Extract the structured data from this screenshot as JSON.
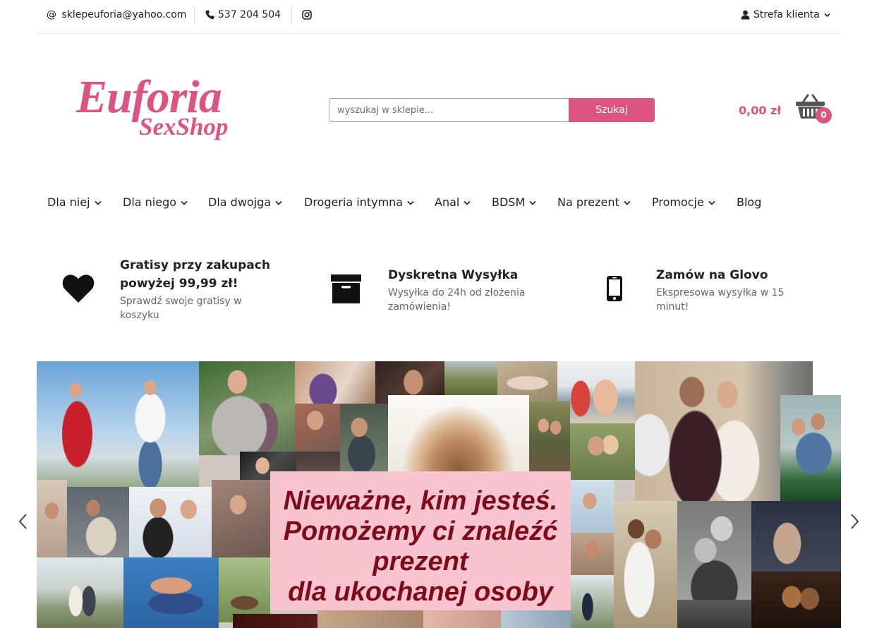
{
  "topbar": {
    "email": "sklepeuforia@yahoo.com",
    "phone": "537 204 504",
    "account_label": "Strefa klienta",
    "icons": [
      "at-icon",
      "phone-icon",
      "instagram-icon",
      "user-icon",
      "chevron-down-icon"
    ]
  },
  "logo": {
    "main": "Euforia",
    "sub": "SexShop"
  },
  "search": {
    "placeholder": "wyszukaj w sklepie...",
    "button_label": "Szukaj"
  },
  "cart": {
    "total": "0,00 zł",
    "count": "0",
    "icon": "basket-icon"
  },
  "nav": {
    "items": [
      {
        "label": "Dla niej",
        "has_dropdown": true
      },
      {
        "label": "Dla niego",
        "has_dropdown": true
      },
      {
        "label": "Dla dwojga",
        "has_dropdown": true
      },
      {
        "label": "Drogeria intymna",
        "has_dropdown": true
      },
      {
        "label": "Anal",
        "has_dropdown": true
      },
      {
        "label": "BDSM",
        "has_dropdown": true
      },
      {
        "label": "Na prezent",
        "has_dropdown": true
      },
      {
        "label": "Promocje",
        "has_dropdown": true
      },
      {
        "label": "Blog",
        "has_dropdown": false
      }
    ]
  },
  "features": [
    {
      "icon": "heart-icon",
      "title": "Gratisy przy zakupach powyżej 99,99 zł!",
      "subtitle": "Sprawdź swoje gratisy w koszyku"
    },
    {
      "icon": "archive-box-icon",
      "title": "Dyskretna Wysyłka",
      "subtitle": "Wysyłka do 24h od złożenia zamówienia!"
    },
    {
      "icon": "mobile-phone-icon",
      "title": "Zamów na Glovo",
      "subtitle": "Ekspresowa wysyłka w 15 minut!"
    }
  ],
  "banner": {
    "lines": [
      "Nieważne, kim jesteś.",
      "Pomożemy ci znaleźć",
      "prezent",
      "dla ukochanej osoby"
    ],
    "arrows": [
      "chevron-left-icon",
      "chevron-right-icon"
    ]
  },
  "colors": {
    "accent": "#dc5580",
    "banner_text": "#7f0b1a",
    "banner_box": "#f8c4cf"
  }
}
